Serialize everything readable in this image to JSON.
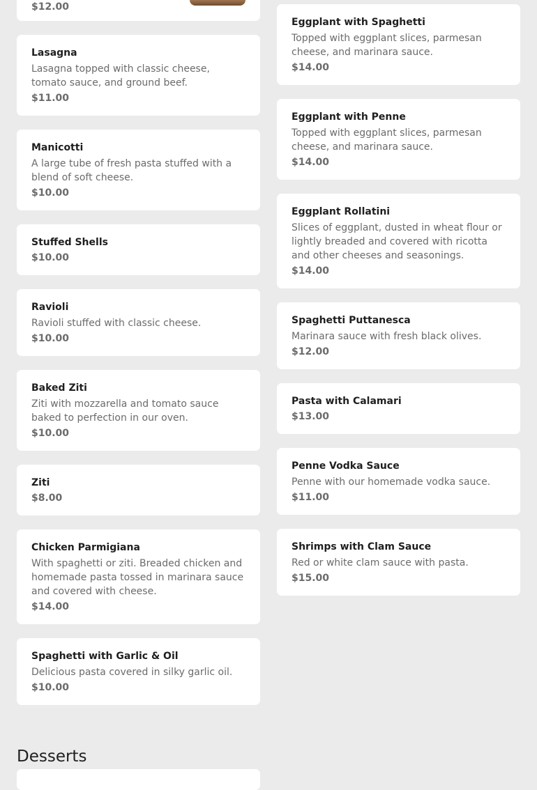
{
  "menu": {
    "left_column": [
      {
        "price": "$12.00",
        "has_image": true
      },
      {
        "name": "Lasagna",
        "description": "Lasagna topped with classic cheese, tomato sauce, and ground beef.",
        "price": "$11.00"
      },
      {
        "name": "Manicotti",
        "description": "A large tube of fresh pasta stuffed with a blend of soft cheese.",
        "price": "$10.00"
      },
      {
        "name": "Stuffed Shells",
        "price": "$10.00"
      },
      {
        "name": "Ravioli",
        "description": "Ravioli stuffed with classic cheese.",
        "price": "$10.00"
      },
      {
        "name": "Baked Ziti",
        "description": "Ziti with mozzarella and tomato sauce baked to perfection in our oven.",
        "price": "$10.00"
      },
      {
        "name": "Ziti",
        "price": "$8.00"
      },
      {
        "name": "Chicken Parmigiana",
        "description": "With spaghetti or ziti. Breaded chicken and homemade pasta tossed in marinara sauce and covered with cheese.",
        "price": "$14.00"
      },
      {
        "name": "Spaghetti with Garlic & Oil",
        "description": "Delicious pasta covered in silky garlic oil.",
        "price": "$10.00"
      }
    ],
    "right_column": [
      {
        "name": "Eggplant with Spaghetti",
        "description": "Topped with eggplant slices, parmesan cheese, and marinara sauce.",
        "price": "$14.00"
      },
      {
        "name": "Eggplant with Penne",
        "description": "Topped with eggplant slices, parmesan cheese, and marinara sauce.",
        "price": "$14.00"
      },
      {
        "name": "Eggplant Rollatini",
        "description": "Slices of eggplant, dusted in wheat flour or lightly breaded and covered with ricotta and other cheeses and seasonings.",
        "price": "$14.00"
      },
      {
        "name": "Spaghetti Puttanesca",
        "description": "Marinara sauce with fresh black olives.",
        "price": "$12.00"
      },
      {
        "name": "Pasta with Calamari",
        "price": "$13.00"
      },
      {
        "name": "Penne Vodka Sauce",
        "description": "Penne with our homemade vodka sauce.",
        "price": "$11.00"
      },
      {
        "name": "Shrimps with Clam Sauce",
        "description": "Red or white clam sauce with pasta.",
        "price": "$15.00"
      }
    ]
  },
  "next_section": {
    "title": "Desserts"
  },
  "colors": {
    "page_background": "#ebebeb",
    "card_background": "#ffffff",
    "name_text": "#1f1f1f",
    "secondary_text": "#6b6b6b"
  }
}
